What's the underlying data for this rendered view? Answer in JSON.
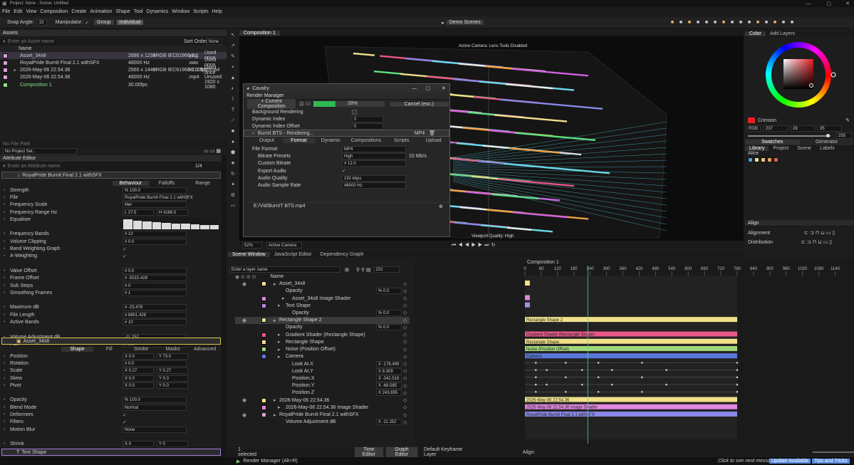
{
  "window": {
    "title": "Project: None - Scene: Untitled"
  },
  "menu": [
    "File",
    "Edit",
    "View",
    "Composition",
    "Create",
    "Animation",
    "Shape",
    "Tool",
    "Dynamics",
    "Window",
    "Scripts",
    "Help"
  ],
  "toolbar": {
    "snap_label": "Snap Angle:",
    "snap_value": "15",
    "manip_label": "Manipulator:",
    "group": "Group",
    "individual": "Individual",
    "demo": "Demo Scenes"
  },
  "assets": {
    "title": "Assets",
    "search_placeholder": "Enter an Asset name",
    "sort_label": "Sort Order",
    "sort_value": "None",
    "col_name": "Name",
    "items": [
      {
        "name": "Asset_34x8",
        "info": "2686 x 1238",
        "cs": "sRGB IEC61966-2.1",
        "type": ".png",
        "usage": "Used once",
        "color": "#d8a0d8",
        "sel": true
      },
      {
        "name": "RoyalPride BurnIt Final 2.1 withSFX",
        "info": "48000 Hz",
        "cs": "",
        "type": ".wav",
        "usage": "Used once",
        "color": "#d8a0d8"
      },
      {
        "name": "2026-May-06 22.54.36",
        "info": "2560 x 1440",
        "cs": "sRGB IEC61966-2.1  922f",
        "type": "30.00fps  .mp4",
        "usage": "Used once",
        "color": "#d8a0d8"
      },
      {
        "name": "2026-May-06 22.54.36",
        "info": "48000 Hz",
        "cs": "",
        "type": ".mp4",
        "usage": "Unused",
        "color": "#d8a0d8"
      },
      {
        "name": "Composition 1",
        "info": "30.00fps",
        "cs": "",
        "type": "",
        "usage": "1920 x 1080",
        "color": "#8ae08a",
        "comp": true
      }
    ],
    "file_path_label": "No File Path",
    "project_set": "No Project Set..."
  },
  "attr": {
    "title": "Attribute Editor",
    "search_placeholder": "Enter an Attribute name",
    "count": "1/4",
    "layer1": "RoyalPride BurnIt Final 2.1 withSFX",
    "tabs1": [
      "Behaviour",
      "Falloffs",
      "Range"
    ],
    "rows1": [
      {
        "k": "Strength",
        "v": "% 100.0"
      },
      {
        "k": "File",
        "v": "RoyalPride BurnIt Final 2.1 withSFX"
      },
      {
        "k": "Frequency Scale",
        "v": "Mel"
      },
      {
        "k": "Frequency Range Hz",
        "v": "L 27.5",
        "v2": "H 4186.0"
      },
      {
        "k": "Equaliser",
        "v": ""
      },
      {
        "k": "",
        "v": ""
      },
      {
        "k": "Frequency Bands",
        "v": "# 10"
      },
      {
        "k": "Volume Clipping",
        "v": "# 0.0"
      },
      {
        "k": "Band Weighting Graph",
        "v": ""
      },
      {
        "k": "A-Weighting",
        "v": ""
      },
      {
        "k": "",
        "v": ""
      },
      {
        "k": "Value Offset",
        "v": "# 0.0"
      },
      {
        "k": "Frame Offset",
        "v": "# -5515.428"
      },
      {
        "k": "Sub Steps",
        "v": "# 0"
      },
      {
        "k": "Smoothing Frames",
        "v": "# 1"
      },
      {
        "k": "",
        "v": ""
      },
      {
        "k": "Maximum dB",
        "v": "# -23.478"
      },
      {
        "k": "File Length",
        "v": "# 6801.428"
      },
      {
        "k": "Active Bands",
        "v": "# 10"
      },
      {
        "k": "",
        "v": ""
      },
      {
        "k": "Volume Adjustment dB",
        "v": "-11.252"
      },
      {
        "k": "Pan",
        "v": "# 0.0"
      }
    ],
    "layer2": "Asset_34x8",
    "tabs2": [
      "Shape",
      "Fill",
      "Stroke",
      "Masks",
      "Advanced"
    ],
    "rows2": [
      {
        "k": "Position",
        "v": "X 0.0",
        "v2": "Y 73.0"
      },
      {
        "k": "Rotation",
        "v": "# 0.0"
      },
      {
        "k": "Scale",
        "v": "X 0.27",
        "v2": "Y 0.27"
      },
      {
        "k": "Skew",
        "v": "X 0.0",
        "v2": "Y 0.0"
      },
      {
        "k": "Pivot",
        "v": "X 0.0",
        "v2": "Y 0.0"
      },
      {
        "k": "",
        "v": ""
      },
      {
        "k": "Opacity",
        "v": "% 100.0"
      },
      {
        "k": "Blend Mode",
        "v": "Normal"
      },
      {
        "k": "Deformers",
        "v": ""
      },
      {
        "k": "Filters",
        "v": ""
      },
      {
        "k": "Motion Blur",
        "v": "None"
      },
      {
        "k": "",
        "v": ""
      },
      {
        "k": "Shrink",
        "v": "X 0",
        "v2": "Y 0"
      },
      {
        "k": "Size",
        "v": "X 2686",
        "v2": "Y 1238"
      }
    ],
    "layer3": "Text Shape",
    "tabs3": [
      "Shape",
      "Background",
      "Fill",
      "Stroke",
      "Masks",
      "Advanced"
    ]
  },
  "viewport": {
    "tab": "Composition 1",
    "camera_msg": "Active Camera: Lens Tools Disabled",
    "quality": "Viewport Quality: High",
    "zoom": "52%",
    "camera": "Active Camera"
  },
  "render": {
    "app": "Cavalry",
    "title": "Render Manager",
    "current": "+ Current Composition",
    "all": "All",
    "progress_pct": "28%",
    "progress": 0.28,
    "cancel": "Cancel (esc.)",
    "bg": "Background Rendering",
    "dyn": "Dynamic Index",
    "dyn_v": "0",
    "dyn_off": "Dynamic Index Offset",
    "dyn_off_v": "0",
    "job": "BurnIt BTS - Rendering...",
    "job_fmt": "MP4",
    "tabs": [
      "Output",
      "Format",
      "Dynamic",
      "Compositions",
      "Scripts",
      "Upload"
    ],
    "rows": [
      {
        "k": "File Format",
        "v": "MP4"
      },
      {
        "k": "Bitrate Presets",
        "v": "High",
        "extra": "10 Mb/s"
      },
      {
        "k": "Custom Bitrate",
        "v": "# 12.0"
      },
      {
        "k": "Export Audio",
        "v": "✓"
      },
      {
        "k": "Audio Quality",
        "v": "192 kbps"
      },
      {
        "k": "Audio Sample Rate",
        "v": "48000 Hz"
      }
    ],
    "path": "E:/Vid/BurnIT BTS.mp4"
  },
  "color": {
    "tabs": [
      "Color",
      "Add Layers"
    ],
    "name": "Crimson",
    "mode": "RGB",
    "r": "237",
    "g": "28",
    "b": "35",
    "alpha": "255",
    "swatch_tabs": [
      "Swatches",
      "Generator"
    ],
    "lib_tabs": [
      "Library",
      "Project",
      "Scene",
      "Labels"
    ],
    "palette": "Alice",
    "palette_colors": [
      "#5aa0c8",
      "#f0e08a",
      "#f0c080",
      "#e0a060",
      "#e06050"
    ]
  },
  "align": {
    "title": "Align",
    "alignment": "Alignment",
    "distribution": "Distribution"
  },
  "scene": {
    "tabs": [
      "Scene Window",
      "JavaScript Editor",
      "Dependency Graph"
    ],
    "search_placeholder": "Enter a layer name",
    "frame": "231",
    "col_name": "Name",
    "layers": [
      {
        "n": "Asset_34x8",
        "ind": 0,
        "c": "#f0e08a",
        "v": "",
        "top": true
      },
      {
        "n": "Opacity",
        "ind": 1,
        "v": "% 0.0"
      },
      {
        "n": "Asset_34x8 Image Shader",
        "ind": 2,
        "c": "#e088e0",
        "v": ""
      },
      {
        "n": "Text Shape",
        "ind": 1,
        "c": "#b088e8",
        "v": ""
      },
      {
        "n": "Opacity",
        "ind": 2,
        "v": "% 0.0"
      },
      {
        "n": "Rectangle Shape 2",
        "ind": 0,
        "c": "#f0e08a",
        "v": "",
        "top": true,
        "sel": true
      },
      {
        "n": "Opacity",
        "ind": 1,
        "v": "% 0.0"
      },
      {
        "n": "Gradient Shader (Rectangle Shape)",
        "ind": 1,
        "c": "#e85888",
        "v": ""
      },
      {
        "n": "Rectangle Shape",
        "ind": 1,
        "c": "#f0e08a",
        "v": ""
      },
      {
        "n": "Noise (Position Offset)",
        "ind": 1,
        "c": "#a0d878",
        "v": ""
      },
      {
        "n": "Camera",
        "ind": 1,
        "c": "#5878d8",
        "v": ""
      },
      {
        "n": "Look At.X",
        "ind": 2,
        "v": "X -176.499"
      },
      {
        "n": "Look At.Y",
        "ind": 2,
        "v": "X 9.309"
      },
      {
        "n": "Position.X",
        "ind": 2,
        "v": "X -342.516"
      },
      {
        "n": "Position.Y",
        "ind": 2,
        "v": "X -68.585"
      },
      {
        "n": "Position.Z",
        "ind": 2,
        "v": "X 243.655"
      },
      {
        "n": "2026-May-06 22.54.36",
        "ind": 0,
        "c": "#f0e08a",
        "v": "",
        "top": true
      },
      {
        "n": "2026-May-06 22.54.36 Image Shader",
        "ind": 1,
        "c": "#e088e0",
        "v": ""
      },
      {
        "n": "RoyalPride BurnIt Final 2.1 withSFX",
        "ind": 0,
        "c": "#d8a0d8",
        "v": "",
        "top": true
      },
      {
        "n": "Volume Adjustment dB",
        "ind": 1,
        "v": "X -11.252"
      }
    ],
    "selected": "1 selected"
  },
  "timeline": {
    "comp": "Composition 1",
    "ticks": [
      "0",
      "60",
      "120",
      "180",
      "240",
      "300",
      "360",
      "420",
      "480",
      "540",
      "600",
      "660",
      "720",
      "780",
      "840",
      "900",
      "960",
      "1020",
      "1080",
      "1140"
    ],
    "bars": [
      {
        "row": 0,
        "label": "",
        "c": "#f0e08a",
        "from": 0,
        "to": 18
      },
      {
        "row": 2,
        "label": "",
        "c": "#e088e0",
        "from": 0,
        "to": 18
      },
      {
        "row": 3,
        "label": "",
        "c": "#b088e8",
        "from": 0,
        "to": 18
      },
      {
        "row": 5,
        "label": "Rectangle Shape 2",
        "c": "#f0e08a",
        "from": 0,
        "to": 780
      },
      {
        "row": 7,
        "label": "Gradient Shader (Rectangle Shape)",
        "c": "#e85888",
        "from": 0,
        "to": 780
      },
      {
        "row": 8,
        "label": "Rectangle Shape",
        "c": "#f0e08a",
        "from": 0,
        "to": 780
      },
      {
        "row": 9,
        "label": "Noise (Position Offset)",
        "c": "#a0d878",
        "from": 0,
        "to": 780
      },
      {
        "row": 10,
        "label": "Camera",
        "c": "#5878d8",
        "from": 0,
        "to": 780
      },
      {
        "row": 16,
        "label": "2026-May-06 22.54.36",
        "c": "#f0e08a",
        "from": 0,
        "to": 780
      },
      {
        "row": 17,
        "label": "2026-May-06 22.54.36 Image Shader",
        "c": "#e088e0",
        "from": 0,
        "to": 780
      },
      {
        "row": 18,
        "label": "RoyalPride BurnIt Final 2.1 withSFX",
        "c": "#8888e8",
        "from": 0,
        "to": 780
      }
    ],
    "playhead": 231
  },
  "bottom": {
    "time_editor": "Time Editor",
    "graph_editor": "Graph Editor",
    "default_layer": "Default Keyframe Layer",
    "align": "Align:",
    "render_mgr": "Render Manager (Alt+R)",
    "msg": "Click to see next message",
    "update": "Update Available",
    "tips": "Tips and Tricks"
  }
}
